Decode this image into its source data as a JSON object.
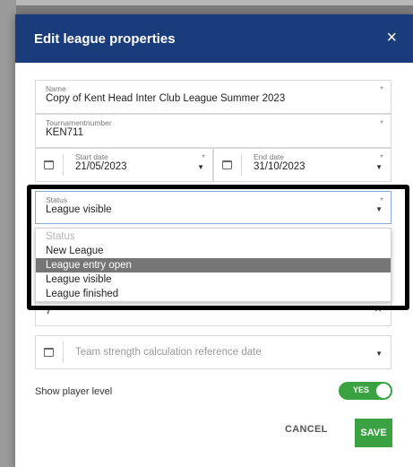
{
  "dialog": {
    "title": "Edit league properties",
    "close_glyph": "×"
  },
  "fields": {
    "name": {
      "label": "Name",
      "value": "Copy of Kent Head Inter Club League Summer 2023"
    },
    "tournamentnumber": {
      "label": "Tournamentnumber",
      "value": "KEN711"
    },
    "start_date": {
      "label": "Start date",
      "value": "21/05/2023"
    },
    "end_date": {
      "label": "End date",
      "value": "31/10/2023"
    },
    "status": {
      "label": "Status",
      "value": "League visible"
    },
    "hidden_field": {
      "value": "7"
    },
    "team_strength": {
      "placeholder": "Team strength calculation reference date"
    },
    "required_marker": "*"
  },
  "status_dropdown": {
    "header": "Status",
    "options": [
      "New League",
      "League entry open",
      "League visible",
      "League finished"
    ],
    "highlighted_index": 1
  },
  "show_player_level": {
    "label": "Show player level",
    "toggle": "YES",
    "on": true
  },
  "buttons": {
    "cancel": "CANCEL",
    "save": "SAVE"
  },
  "colors": {
    "header": "#1a3c7a",
    "accent_green": "#3aa241",
    "highlight": "#767676"
  },
  "icons": {
    "calendar": "calendar-icon",
    "caret": "caret-down-icon",
    "close": "close-icon"
  }
}
